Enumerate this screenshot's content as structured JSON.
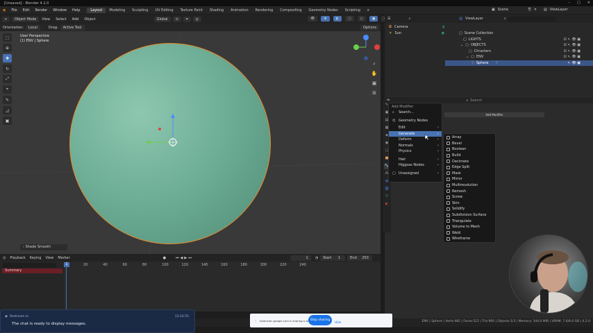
{
  "titlebar": {
    "title": "[Unsaved] - Blender 4.2.0"
  },
  "menu": [
    "File",
    "Edit",
    "Render",
    "Window",
    "Help"
  ],
  "workspaces": [
    {
      "label": "Layout",
      "active": true
    },
    {
      "label": "Modeling"
    },
    {
      "label": "Sculpting"
    },
    {
      "label": "UV Editing"
    },
    {
      "label": "Texture Paint"
    },
    {
      "label": "Shading"
    },
    {
      "label": "Animation"
    },
    {
      "label": "Rendering"
    },
    {
      "label": "Compositing"
    },
    {
      "label": "Geometry Nodes"
    },
    {
      "label": "Scripting"
    }
  ],
  "scene": {
    "label": "Scene",
    "view_layer": "ViewLayer"
  },
  "viewport_header": {
    "mode": "Object Mode",
    "menus": [
      "View",
      "Select",
      "Add",
      "Object"
    ],
    "transform": "Global",
    "options": "Options"
  },
  "viewport_header2": {
    "orientation_label": "Orientation:",
    "orientation": "Local",
    "drag_label": "Drag:",
    "drag": "Active Tool"
  },
  "viewport_info": {
    "line1": "User Perspective",
    "line2": "(1) ENV | Sphere"
  },
  "shade_smooth": "Shade Smooth",
  "outliner": {
    "search_placeholder": "",
    "rows": [
      {
        "label": "Scene Collection",
        "indent": 0
      },
      {
        "label": "LIGHTS",
        "indent": 1
      },
      {
        "label": "OBJECTS",
        "indent": 1
      },
      {
        "label": "Chracters",
        "indent": 2
      },
      {
        "label": "ENV",
        "indent": 2
      },
      {
        "label": "Sphere",
        "indent": 3,
        "selected": true
      }
    ],
    "left_rows": [
      {
        "label": "Camera"
      },
      {
        "label": "Sun"
      }
    ]
  },
  "properties": {
    "add_modifier": "Add Modifier",
    "search_placeholder": "Search"
  },
  "add_modifier_menu": {
    "title": "Add Modifier",
    "search": "Search...",
    "items": [
      {
        "label": "Geometry Nodes",
        "sub": false
      },
      {
        "label": "Edit",
        "sub": true
      },
      {
        "label": "Generate",
        "sub": true,
        "highlight": true
      },
      {
        "label": "Deform",
        "sub": true
      },
      {
        "label": "Normals",
        "sub": true
      },
      {
        "label": "Physics",
        "sub": true
      },
      {
        "label": "Hair",
        "sub": true
      },
      {
        "label": "Higgsas Nodes",
        "sub": true
      },
      {
        "label": "Unassigned",
        "sub": false
      }
    ]
  },
  "generate_menu": [
    "Array",
    "Bevel",
    "Boolean",
    "Build",
    "Decimate",
    "Edge Split",
    "Mask",
    "Mirror",
    "Multiresolution",
    "Remesh",
    "Screw",
    "Skin",
    "Solidify",
    "Subdivision Surface",
    "Triangulate",
    "Volume to Mesh",
    "Weld",
    "Wireframe"
  ],
  "timeline": {
    "menus": [
      "Playback",
      "Keying",
      "View",
      "Marker"
    ],
    "current_frame": "1",
    "start_label": "Start",
    "start": "1",
    "end_label": "End",
    "end": "250",
    "ticks": [
      "20",
      "40",
      "60",
      "80",
      "100",
      "120",
      "140",
      "160",
      "180",
      "200",
      "220",
      "240"
    ],
    "summary": "Summary",
    "frame": "1"
  },
  "notify": {
    "source": "Restream.io",
    "time": "13:14:55",
    "message": "The chat is ready to display messages."
  },
  "share": {
    "text": "extension.google.com is sharing a window.",
    "stop": "Stop sharing",
    "hide": "Hide"
  },
  "statusbar": {
    "right": "ENV | Sphere | Verts:482 | Faces:512 | Tris:960 | Objects:1/3 | Memory: 344.0 MiB | VRAM: 7.0/8.0 GB | 4.2.0"
  },
  "colors": {
    "accent": "#4772b3",
    "selection_outline": "#e88a2a",
    "sphere": "#6fae97"
  }
}
